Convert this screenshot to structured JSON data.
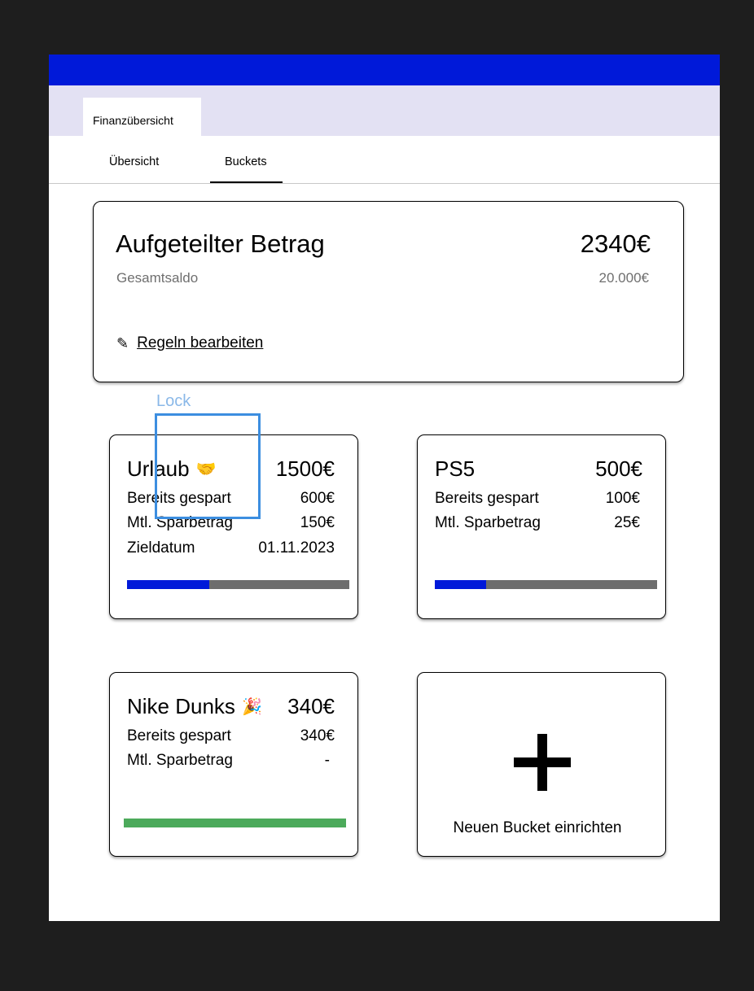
{
  "browser_tab": {
    "label": "Finanzübersicht"
  },
  "nav_tabs": [
    {
      "label": "Übersicht",
      "active": false
    },
    {
      "label": "Buckets",
      "active": true
    }
  ],
  "summary": {
    "title": "Aufgeteilter Betrag",
    "amount": "2340€",
    "subtitle": "Gesamtsaldo",
    "sub_amount": "20.000€",
    "edit_label": "Regeln bearbeiten",
    "edit_icon": "pencil-icon"
  },
  "buckets": [
    {
      "name": "Urlaub",
      "emoji": "🤝",
      "icon": "handshake-icon",
      "amount": "1500€",
      "rows": [
        {
          "label": "Bereits gespart",
          "value": "600€"
        },
        {
          "label": "Mtl. Sparbetrag",
          "value": "150€"
        },
        {
          "label": "Zieldatum",
          "value": "01.11.2023"
        }
      ],
      "progress": 0.37
    },
    {
      "name": "PS5",
      "amount": "500€",
      "rows": [
        {
          "label": "Bereits gespart",
          "value": "100€"
        },
        {
          "label": "Mtl. Sparbetrag",
          "value": "25€"
        }
      ],
      "progress": 0.23
    },
    {
      "name": "Nike Dunks",
      "emoji": "🎉",
      "icon": "party-popper-icon",
      "amount": "340€",
      "rows": [
        {
          "label": "Bereits gespart",
          "value": "340€"
        },
        {
          "label": "Mtl. Sparbetrag",
          "value": "-"
        }
      ],
      "progress": 1.0
    }
  ],
  "new_bucket": {
    "label": "Neuen Bucket einrichten",
    "icon": "plus-icon"
  },
  "annotation": {
    "label": "Lock"
  },
  "colors": {
    "accent": "#0019d9",
    "tab_strip": "#e3e1f3",
    "progress_track": "#6d6d6d",
    "complete": "#4caa5b",
    "annotation": "#3c8ee0"
  }
}
